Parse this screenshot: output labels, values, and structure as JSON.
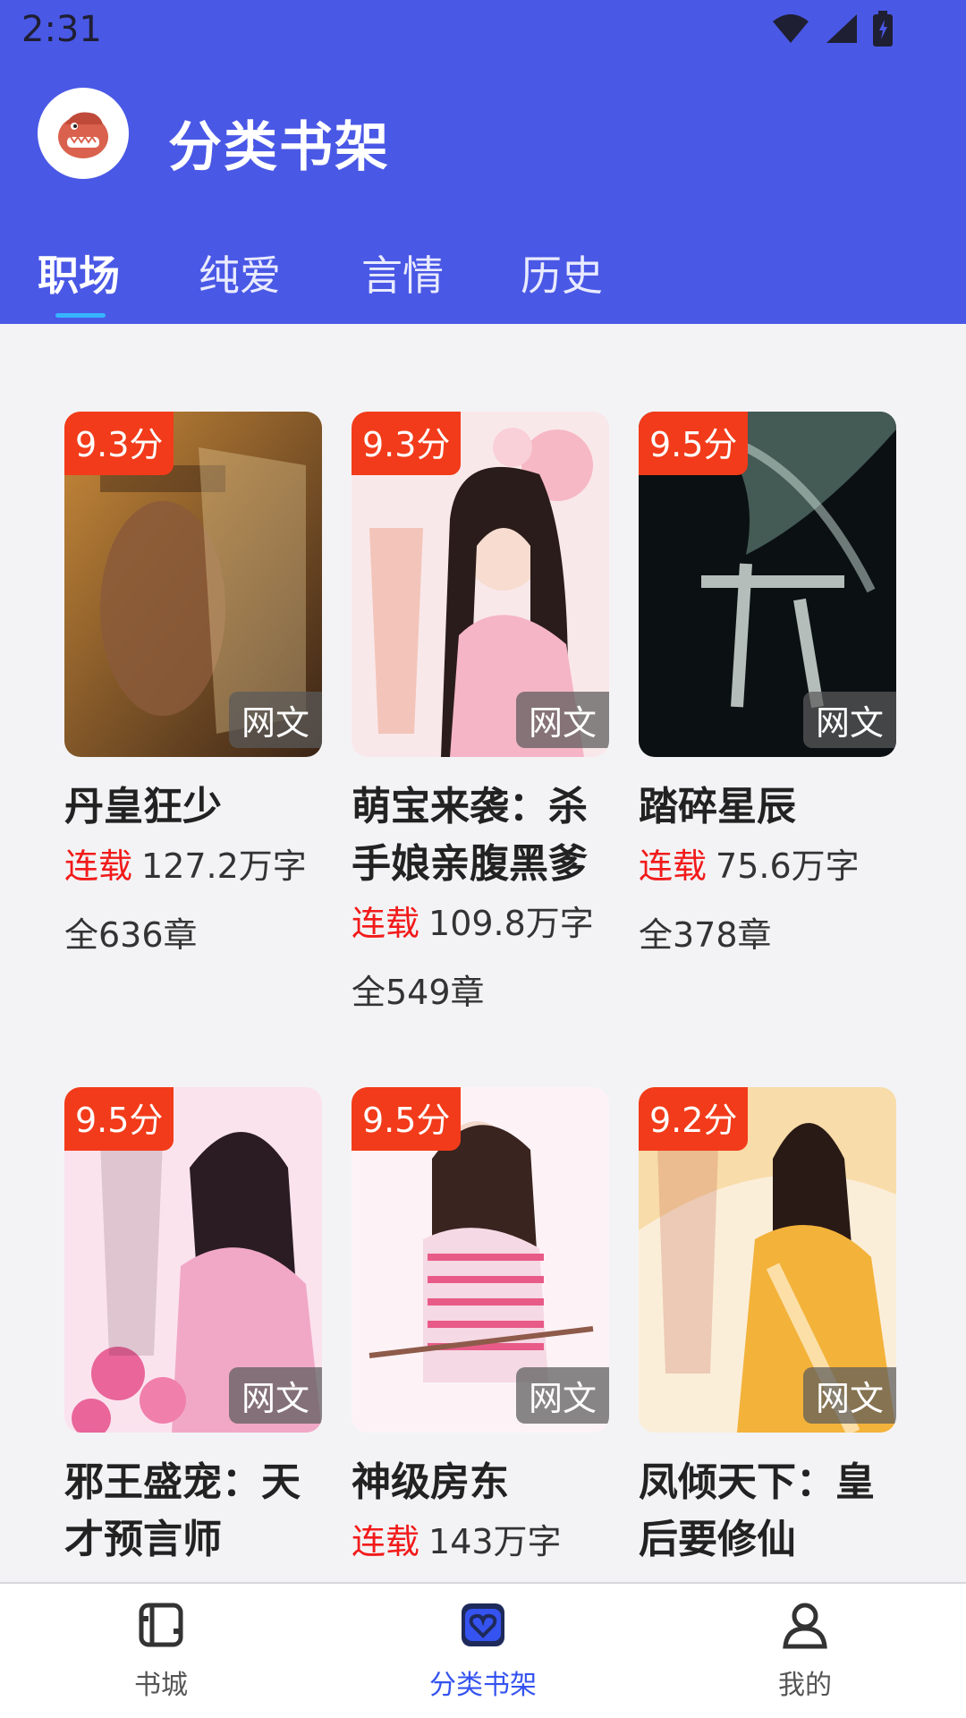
{
  "status_bar": {
    "time": "2:31"
  },
  "app": {
    "title": "分类书架"
  },
  "tabs": [
    {
      "label": "职场",
      "active": true
    },
    {
      "label": "纯爱",
      "active": false
    },
    {
      "label": "言情",
      "active": false
    },
    {
      "label": "历史",
      "active": false
    }
  ],
  "books": [
    {
      "title": "丹皇狂少",
      "score": "9.3分",
      "tag": "网文",
      "status": "连载",
      "words": "127.2万字",
      "chapters": "全636章",
      "cover_colors": [
        "#5a3a22",
        "#c98a3a"
      ]
    },
    {
      "title": "萌宝来袭：杀手娘亲腹黑爹",
      "score": "9.3分",
      "tag": "网文",
      "status": "连载",
      "words": "109.8万字",
      "chapters": "全549章",
      "cover_colors": [
        "#f6c9cf",
        "#f9e8ea"
      ]
    },
    {
      "title": "踏碎星辰",
      "score": "9.5分",
      "tag": "网文",
      "status": "连载",
      "words": "75.6万字",
      "chapters": "全378章",
      "cover_colors": [
        "#0b1012",
        "#5c7a70"
      ]
    },
    {
      "title": "邪王盛宠：天才预言师",
      "score": "9.5分",
      "tag": "网文",
      "status": "",
      "words": "",
      "chapters": "",
      "cover_colors": [
        "#f1a8c6",
        "#fbe3ee"
      ]
    },
    {
      "title": "神级房东",
      "score": "9.5分",
      "tag": "网文",
      "status": "连载",
      "words": "143万字",
      "chapters": "",
      "cover_colors": [
        "#f5d9e4",
        "#fdf3f6"
      ]
    },
    {
      "title": "凤倾天下：皇后要修仙",
      "score": "9.2分",
      "tag": "网文",
      "status": "",
      "words": "",
      "chapters": "",
      "cover_colors": [
        "#f6c97a",
        "#fbeed9"
      ]
    }
  ],
  "bottom_nav": [
    {
      "label": "书城",
      "icon": "book-store-icon",
      "active": false
    },
    {
      "label": "分类书架",
      "icon": "heart-bookshelf-icon",
      "active": true
    },
    {
      "label": "我的",
      "icon": "user-icon",
      "active": false
    }
  ],
  "colors": {
    "primary": "#4a58e6",
    "accent": "#3553f0",
    "score_bg": "#f23b1a",
    "serial": "#f21a1a"
  }
}
